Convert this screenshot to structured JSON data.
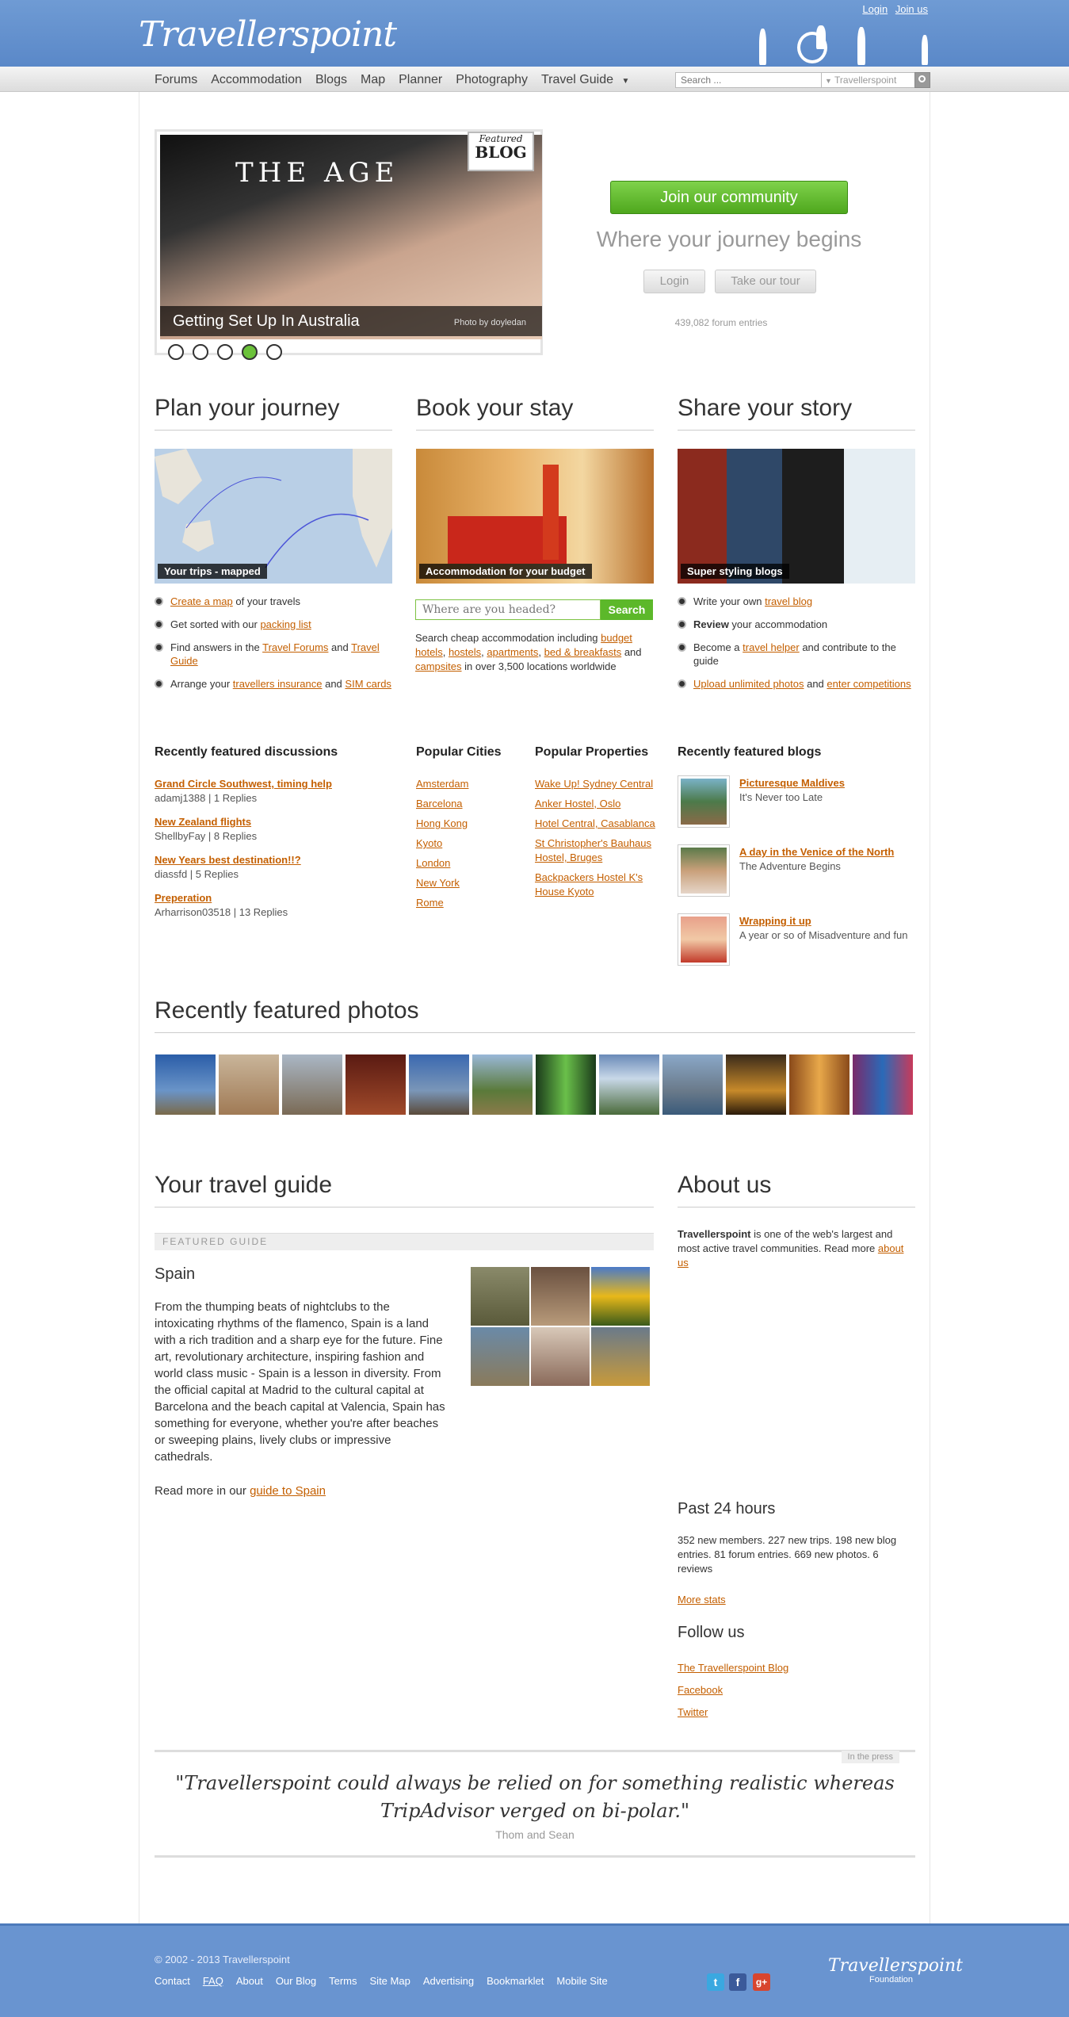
{
  "header": {
    "logo": "Travellerspoint",
    "login": "Login",
    "join": "Join us"
  },
  "nav": {
    "items": [
      "Forums",
      "Accommodation",
      "Blogs",
      "Map",
      "Planner",
      "Photography",
      "Travel Guide"
    ],
    "search_placeholder": "Search ...",
    "search_scope": "Travellerspoint"
  },
  "slider": {
    "title": "Getting Set Up In Australia",
    "credit": "Photo by doyledan",
    "badge_top": "Featured",
    "badge_bottom": "BLOG",
    "sign_text": "THE AGE"
  },
  "hero": {
    "join": "Join our community",
    "tagline": "Where your journey begins",
    "login": "Login",
    "tour": "Take our tour",
    "forum_count": "439,082 forum entries"
  },
  "plan": {
    "heading": "Plan your journey",
    "caption": "Your trips - mapped",
    "items": [
      {
        "a": "Create a map",
        "rest": " of your travels"
      },
      {
        "pre": "Get sorted with our ",
        "a": "packing list"
      },
      {
        "pre": "Find answers in the ",
        "a": "Travel Forums",
        "mid": " and ",
        "a2": "Travel Guide"
      },
      {
        "pre": "Arrange your ",
        "a": "travellers insurance",
        "mid": " and ",
        "a2": "SIM cards"
      }
    ]
  },
  "book": {
    "heading": "Book your stay",
    "caption": "Accommodation for your budget",
    "placeholder": "Where are you headed?",
    "button": "Search",
    "text_pre": "Search cheap accommodation including ",
    "links": [
      "budget hotels",
      "hostels",
      "apartments",
      "bed & breakfasts",
      "campsites"
    ],
    "text_post": " in over 3,500 locations worldwide"
  },
  "share": {
    "heading": "Share your story",
    "caption": "Super styling blogs",
    "items": [
      {
        "pre": "Write your own ",
        "a": "travel blog"
      },
      {
        "b": "Review",
        "rest": " your accommodation"
      },
      {
        "pre": "Become a ",
        "a": "travel helper",
        "rest": " and contribute to the guide"
      },
      {
        "a": "Upload unlimited photos",
        "mid": " and ",
        "a2": "enter competitions"
      }
    ]
  },
  "discussions": {
    "heading": "Recently featured discussions",
    "items": [
      {
        "title": "Grand Circle Southwest, timing help",
        "meta": "adamj1388 | 1 Replies"
      },
      {
        "title": "New Zealand flights",
        "meta": "ShellbyFay | 8 Replies"
      },
      {
        "title": "New Years best destination!!?",
        "meta": "diassfd | 5 Replies"
      },
      {
        "title": "Preperation",
        "meta": "Arharrison03518 | 13 Replies"
      }
    ]
  },
  "cities": {
    "heading": "Popular Cities",
    "items": [
      "Amsterdam",
      "Barcelona",
      "Hong Kong",
      "Kyoto",
      "London",
      "New York",
      "Rome"
    ]
  },
  "properties": {
    "heading": "Popular Properties",
    "items": [
      "Wake Up! Sydney Central",
      "Anker Hostel, Oslo",
      "Hotel Central, Casablanca",
      "St Christopher's Bauhaus Hostel, Bruges",
      "Backpackers Hostel K's House Kyoto"
    ]
  },
  "blogs": {
    "heading": "Recently featured blogs",
    "items": [
      {
        "title": "Picturesque Maldives",
        "sub": "It's Never too Late"
      },
      {
        "title": "A day in the Venice of the North",
        "sub": "The Adventure Begins"
      },
      {
        "title": "Wrapping it up",
        "sub": "A year or so of Misadventure and fun"
      }
    ]
  },
  "photos": {
    "heading": "Recently featured photos",
    "count": 12
  },
  "guide": {
    "heading": "Your travel guide",
    "label": "FEATURED GUIDE",
    "title": "Spain",
    "text": "From the thumping beats of nightclubs to the intoxicating rhythms of the flamenco, Spain is a land with a rich tradition and a sharp eye for the future. Fine art, revolutionary architecture, inspiring fashion and world class music - Spain is a lesson in diversity. From the official capital at Madrid to the cultural capital at Barcelona and the beach capital at Valencia, Spain has something for everyone, whether you're after beaches or sweeping plains, lively clubs or impressive cathedrals.",
    "more_pre": "Read more in our ",
    "more_link": "guide to Spain"
  },
  "about": {
    "heading": "About us",
    "brand": "Travellerspoint",
    "text": " is one of the web's largest and most active travel communities. Read more ",
    "link": "about us"
  },
  "stats": {
    "heading": "Past 24 hours",
    "text": "352 new members. 227 new trips. 198 new blog entries. 81 forum entries. 669 new photos. 6 reviews",
    "more": "More stats"
  },
  "follow": {
    "heading": "Follow us",
    "items": [
      "The Travellerspoint Blog",
      "Facebook",
      "Twitter"
    ]
  },
  "press": {
    "tab": "In the press",
    "quote": "\"Travellerspoint could always be relied on for something realistic whereas TripAdvisor verged on bi-polar.\"",
    "author": "Thom and Sean"
  },
  "footer": {
    "copyright": "© 2002 - 2013  Travellerspoint",
    "links": [
      "Contact",
      "FAQ",
      "About",
      "Our Blog",
      "Terms",
      "Site Map",
      "Advertising",
      "Bookmarklet",
      "Mobile Site"
    ],
    "logo": "Travellerspoint",
    "logo_sub": "Foundation"
  },
  "colors": {
    "header": "#6f9bd4",
    "link": "#c45f00",
    "join": "#5cb82a"
  }
}
